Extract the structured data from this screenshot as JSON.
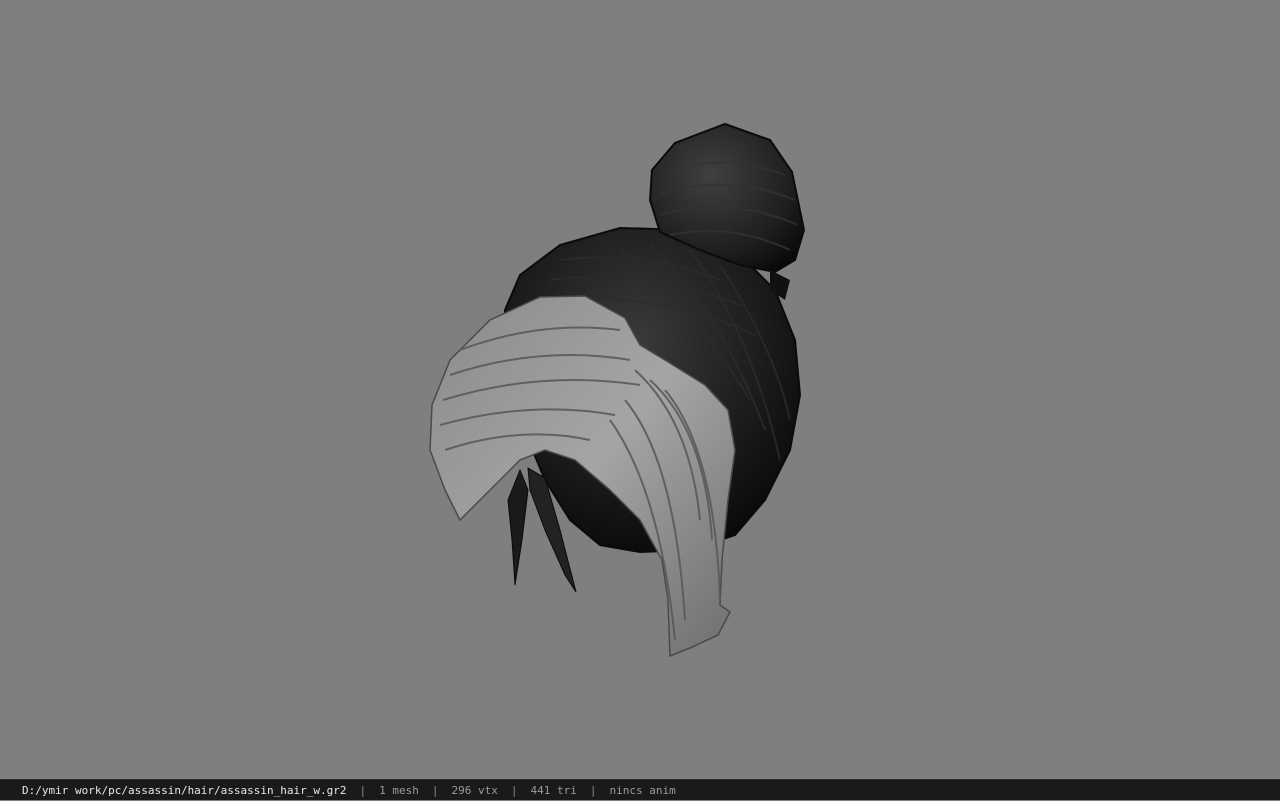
{
  "viewer": {
    "background_color": "#7f7f7f",
    "model": {
      "object": "hair-bun-model",
      "colors": {
        "dark_hair": "#1b1b1b",
        "light_hair": "#9a9a9a"
      }
    }
  },
  "statusbar": {
    "file_path": "D:/ymir work/pc/assassin/hair/assassin_hair_w.gr2",
    "separator": "|",
    "mesh_count": "1 mesh",
    "vertex_count": "296 vtx",
    "triangle_count": "441 tri",
    "anim_status": "nincs anim"
  }
}
